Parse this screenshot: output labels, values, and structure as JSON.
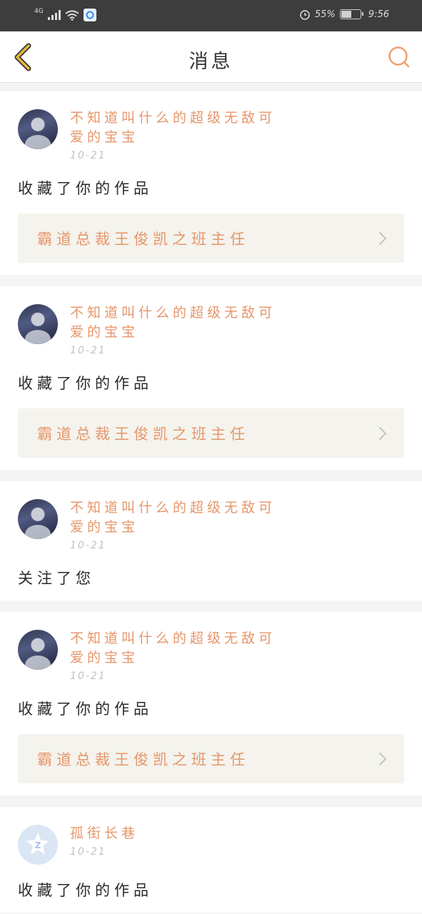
{
  "status_bar": {
    "network": "4G",
    "battery_percent_text": "55%",
    "battery_level": 0.55,
    "time": "9:56"
  },
  "nav": {
    "title": "消息"
  },
  "colors": {
    "accent": "#e6966a",
    "back_arrow": "#e5b63f",
    "search_icon": "#f0a06c"
  },
  "messages": [
    {
      "username": "不知道叫什么的超级无敌可爱的宝宝",
      "date": "10-21",
      "action": "收藏了你的作品",
      "work_title": "霸道总裁王俊凯之班主任"
    },
    {
      "username": "不知道叫什么的超级无敌可爱的宝宝",
      "date": "10-21",
      "action": "收藏了你的作品",
      "work_title": "霸道总裁王俊凯之班主任"
    },
    {
      "username": "不知道叫什么的超级无敌可爱的宝宝",
      "date": "10-21",
      "action": "关注了您"
    },
    {
      "username": "不知道叫什么的超级无敌可爱的宝宝",
      "date": "10-21",
      "action": "收藏了你的作品",
      "work_title": "霸道总裁王俊凯之班主任"
    },
    {
      "username": "孤街长巷",
      "date": "10-21",
      "action": "收藏了你的作品"
    }
  ]
}
